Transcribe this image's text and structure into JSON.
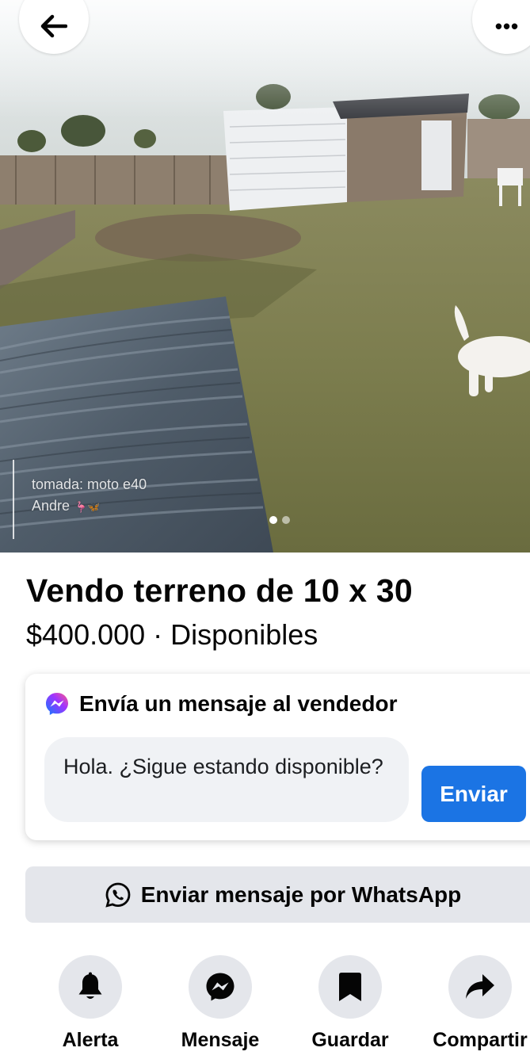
{
  "topbar": {
    "back_icon": "arrow-left-icon",
    "more_icon": "more-horizontal-icon",
    "more_label": "•••"
  },
  "photo": {
    "watermark_line1": "tomada: moto e40",
    "watermark_line2": "Andre",
    "watermark_emojis": [
      "🦩",
      "🦋"
    ],
    "carousel_total": 2,
    "carousel_active": 1
  },
  "listing": {
    "title": "Vendo terreno de 10 x 30",
    "price_line": "$400.000 · Disponibles"
  },
  "message_card": {
    "heading": "Envía un mensaje al vendedor",
    "icon": "messenger-icon",
    "input_value": "Hola. ¿Sigue estando disponible?",
    "send_label": "Enviar"
  },
  "whatsapp": {
    "label": "Enviar mensaje por WhatsApp",
    "icon": "whatsapp-icon"
  },
  "actions": [
    {
      "label": "Alerta",
      "icon": "bell-icon"
    },
    {
      "label": "Mensaje",
      "icon": "messenger-icon"
    },
    {
      "label": "Guardar",
      "icon": "bookmark-icon"
    },
    {
      "label": "Compartir",
      "icon": "share-arrow-icon"
    }
  ],
  "colors": {
    "primary": "#1b74e4",
    "secondary_button": "#e4e6eb",
    "input_bg": "#f0f2f5",
    "text": "#050505"
  }
}
